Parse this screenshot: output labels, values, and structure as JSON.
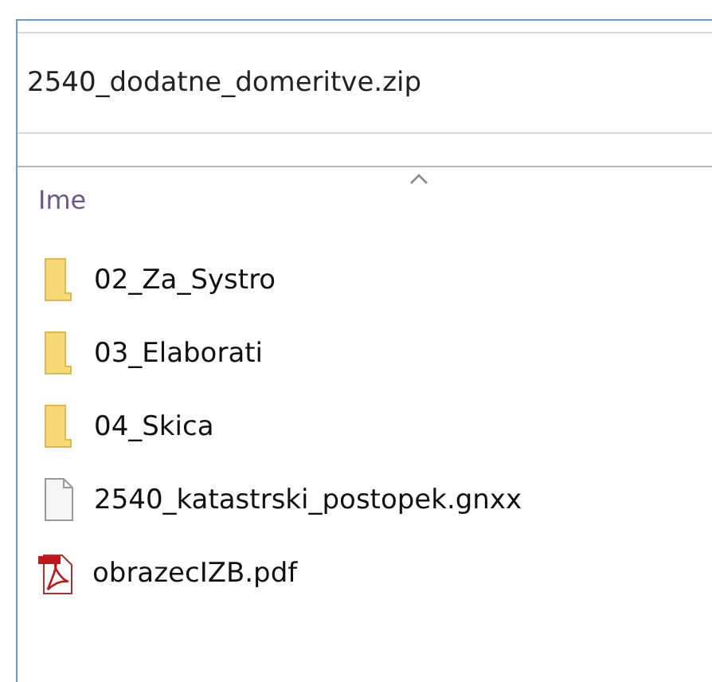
{
  "address_bar": {
    "path": "2540_dodatne_domeritve.zip"
  },
  "file_list": {
    "column": {
      "label": "Ime",
      "sorted_ascending": true
    },
    "items": [
      {
        "name": "02_Za_Systro",
        "kind": "folder"
      },
      {
        "name": "03_Elaborati",
        "kind": "folder"
      },
      {
        "name": "04_Skica",
        "kind": "folder"
      },
      {
        "name": "2540_katastrski_postopek.gnxx",
        "kind": "file"
      },
      {
        "name": "obrazecIZB.pdf",
        "kind": "pdf"
      }
    ]
  }
}
